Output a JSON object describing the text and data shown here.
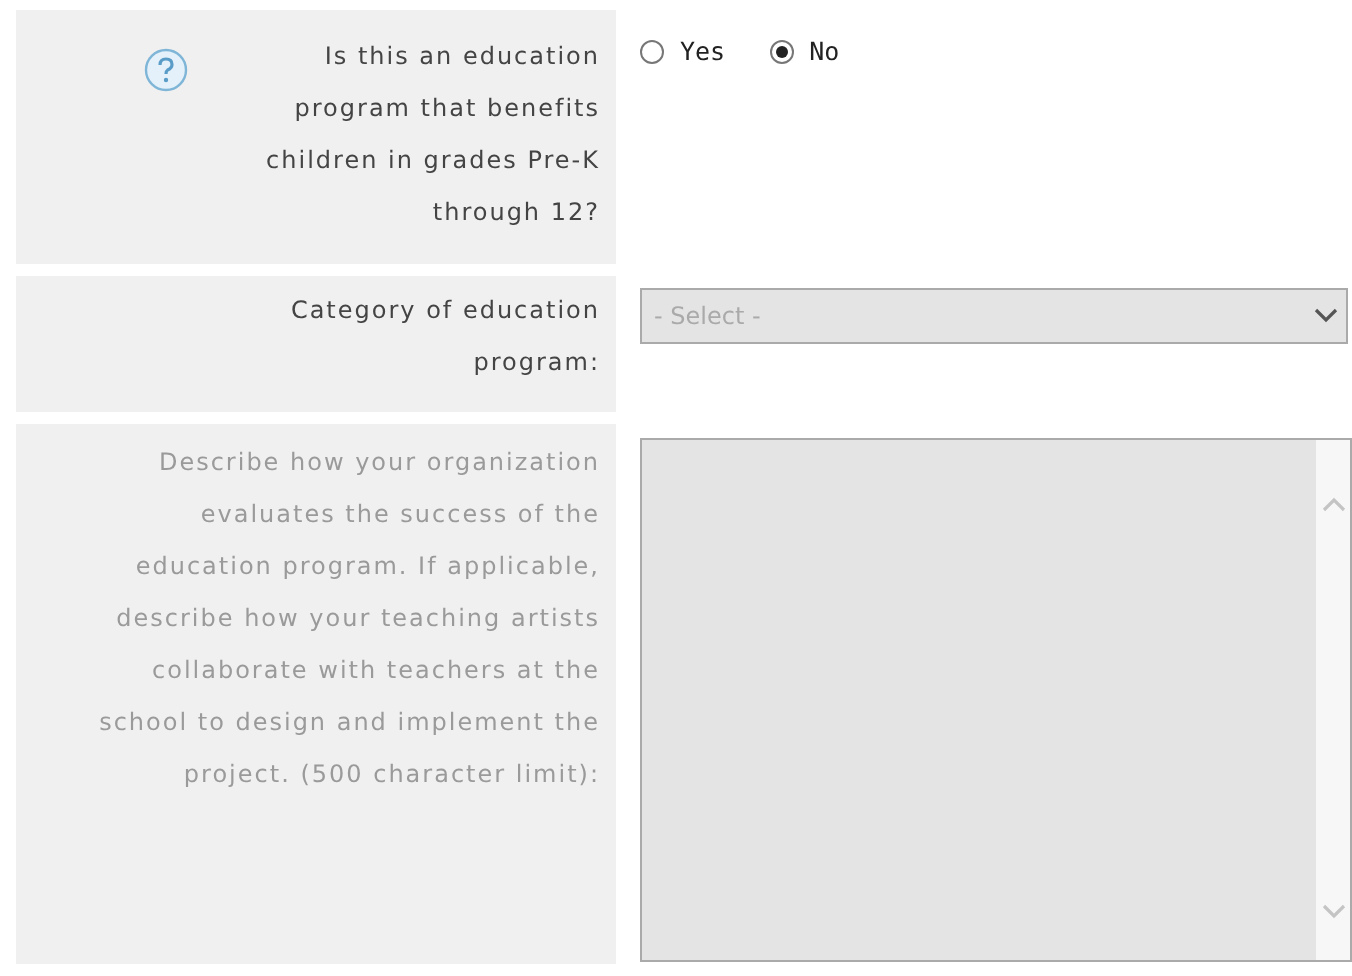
{
  "questions": [
    {
      "kind": "radio",
      "help": true,
      "disabled": false,
      "label": "Is this an education program that benefits children in grades Pre-K through 12?",
      "options": [
        {
          "label": "Yes",
          "selected": false
        },
        {
          "label": "No",
          "selected": true
        }
      ]
    },
    {
      "kind": "select",
      "help": false,
      "disabled": false,
      "label": "Category of education program:",
      "field": {
        "value": "- Select -",
        "disabled": true
      }
    },
    {
      "kind": "textarea",
      "help": false,
      "disabled": true,
      "label": "Describe how your organization evaluates the success of the education program. If applicable, describe how your teaching artists collaborate with teachers at the school to design and implement the project. (500 character limit):",
      "field": {
        "disabled": true
      }
    }
  ]
}
